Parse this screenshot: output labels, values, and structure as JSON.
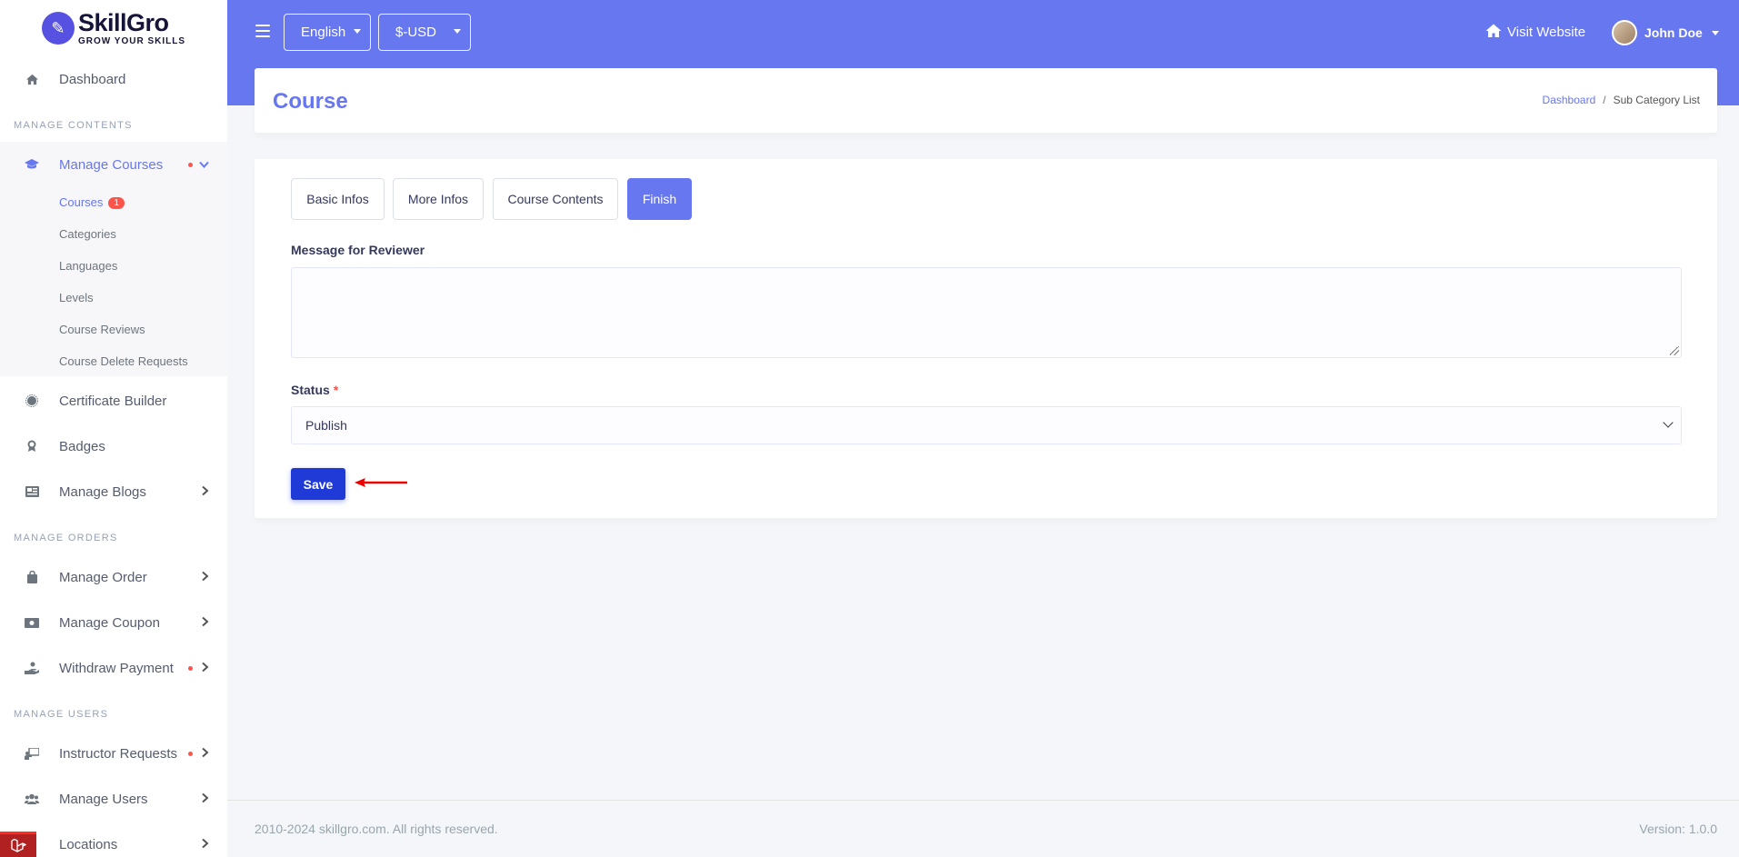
{
  "brand": {
    "name": "SkillGro",
    "tagline": "GROW YOUR SKILLS"
  },
  "sidebar": {
    "dashboard": "Dashboard",
    "header_contents": "MANAGE CONTENTS",
    "manage_courses": "Manage Courses",
    "sub_items": {
      "courses": "Courses",
      "courses_badge": "1",
      "categories": "Categories",
      "languages": "Languages",
      "levels": "Levels",
      "course_reviews": "Course Reviews",
      "course_delete_requests": "Course Delete Requests"
    },
    "certificate_builder": "Certificate Builder",
    "badges": "Badges",
    "manage_blogs": "Manage Blogs",
    "header_orders": "MANAGE ORDERS",
    "manage_order": "Manage Order",
    "manage_coupon": "Manage Coupon",
    "withdraw_payment": "Withdraw Payment",
    "header_users": "MANAGE USERS",
    "instructor_requests": "Instructor Requests",
    "manage_users": "Manage Users",
    "locations": "Locations"
  },
  "topbar": {
    "language": "English",
    "currency": "$-USD",
    "visit_website": "Visit Website",
    "user_name": "John Doe"
  },
  "header": {
    "title": "Course",
    "breadcrumb": {
      "home": "Dashboard",
      "separator": "/",
      "current": "Sub Category List"
    }
  },
  "form": {
    "tabs": {
      "basic": "Basic Infos",
      "more": "More Infos",
      "contents": "Course Contents",
      "finish": "Finish"
    },
    "message_label": "Message for Reviewer",
    "message_value": "",
    "status_label": "Status",
    "required_mark": "*",
    "status_value": "Publish",
    "save_label": "Save"
  },
  "footer": {
    "copyright": "2010-2024 skillgro.com. All rights reserved.",
    "version": "Version: 1.0.0"
  },
  "colors": {
    "primary": "#6777ef",
    "save": "#1f3ad6",
    "danger": "#fc544b"
  }
}
